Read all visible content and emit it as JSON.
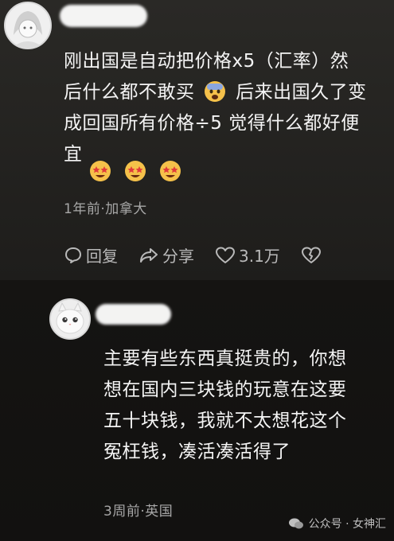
{
  "comments": [
    {
      "lines": [
        "刚出国是自动把价格x5（汇率）然",
        "后什么都不敢买",
        "后来出国久了变",
        "成回国所有价格÷5 觉得什么都好便",
        "宜"
      ],
      "meta": "1年前·加拿大",
      "actions": {
        "reply": "回复",
        "share": "分享",
        "likes": "3.1万"
      },
      "icons": [
        "avatar-anime-girl",
        "fearful-face-emoji",
        "star-struck-emoji",
        "reply-icon",
        "share-icon",
        "heart-icon",
        "broken-heart-icon"
      ]
    },
    {
      "lines": [
        "主要有些东西真挺贵的，你想",
        "想在国内三块钱的玩意在这要",
        "五十块钱，我就不太想花这个",
        "冤枉钱，凑活凑活得了"
      ],
      "meta": "3周前·英国",
      "icons": [
        "avatar-white-cat"
      ]
    }
  ],
  "watermark": "公众号 · 女神汇",
  "colors": {
    "text": "#f4f4f4",
    "meta": "#a7a7a7",
    "top_bg": "#2a2926",
    "bottom_bg": "#151412"
  }
}
